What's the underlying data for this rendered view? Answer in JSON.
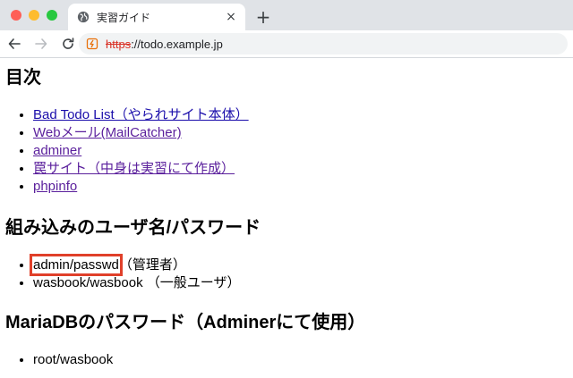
{
  "browser": {
    "tab_title": "実習ガイド",
    "tab_close": "×",
    "new_tab": "+",
    "url_scheme": "https",
    "url_rest": "://todo.example.jp"
  },
  "page": {
    "sections": [
      {
        "heading": "目次",
        "links": [
          "Bad Todo List（やられサイト本体）",
          "Webメール(MailCatcher)",
          "adminer",
          "罠サイト（中身は実習にて作成）",
          "phpinfo"
        ]
      },
      {
        "heading": "組み込みのユーザ名/パスワード",
        "items": [
          {
            "credential": "admin/passwd",
            "note": "（管理者）"
          },
          {
            "credential": "wasbook/wasbook",
            "note": " （一般ユーザ）"
          }
        ]
      },
      {
        "heading": "MariaDBのパスワード（Adminerにて使用）",
        "items": [
          {
            "credential": "root/wasbook"
          }
        ]
      }
    ]
  },
  "colors": {
    "link": "#1a0dab",
    "visited_link": "#5a1f9c",
    "highlight_box": "#e0402a"
  }
}
